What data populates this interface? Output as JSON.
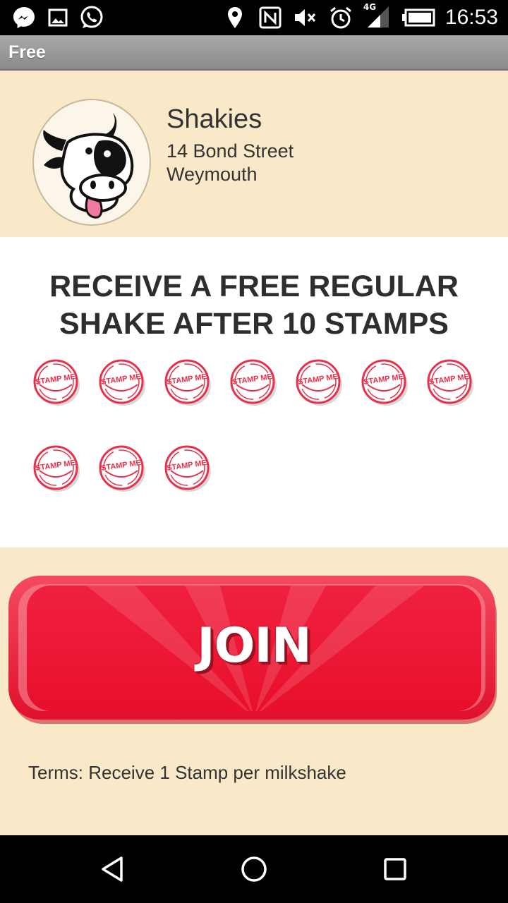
{
  "status_bar": {
    "time": "16:53",
    "network": "4G",
    "left_icons": [
      "messenger-icon",
      "image-icon",
      "whatsapp-icon"
    ],
    "right_icons": [
      "location-icon",
      "nfc-icon",
      "mute-icon",
      "alarm-icon",
      "signal-icon",
      "battery-icon"
    ]
  },
  "action_bar": {
    "title": "Free"
  },
  "store": {
    "name": "Shakies",
    "address_line1": "14 Bond Street",
    "address_line2": "Weymouth",
    "logo_icon": "cow-logo-icon"
  },
  "offer": {
    "title_line1": "RECEIVE A FREE REGULAR",
    "title_line2": "SHAKE AFTER 10 STAMPS",
    "stamp_label": "STAMP ME",
    "stamp_count": 10
  },
  "join": {
    "label": "JOIN"
  },
  "terms": "Terms: Receive 1 Stamp per milkshake",
  "nav": [
    "back-icon",
    "home-icon",
    "recents-icon"
  ],
  "colors": {
    "cream": "#f9e9c8",
    "join_red": "#ee2640",
    "stamp_red": "#e8304b",
    "action_bar_grey": "#999999"
  }
}
